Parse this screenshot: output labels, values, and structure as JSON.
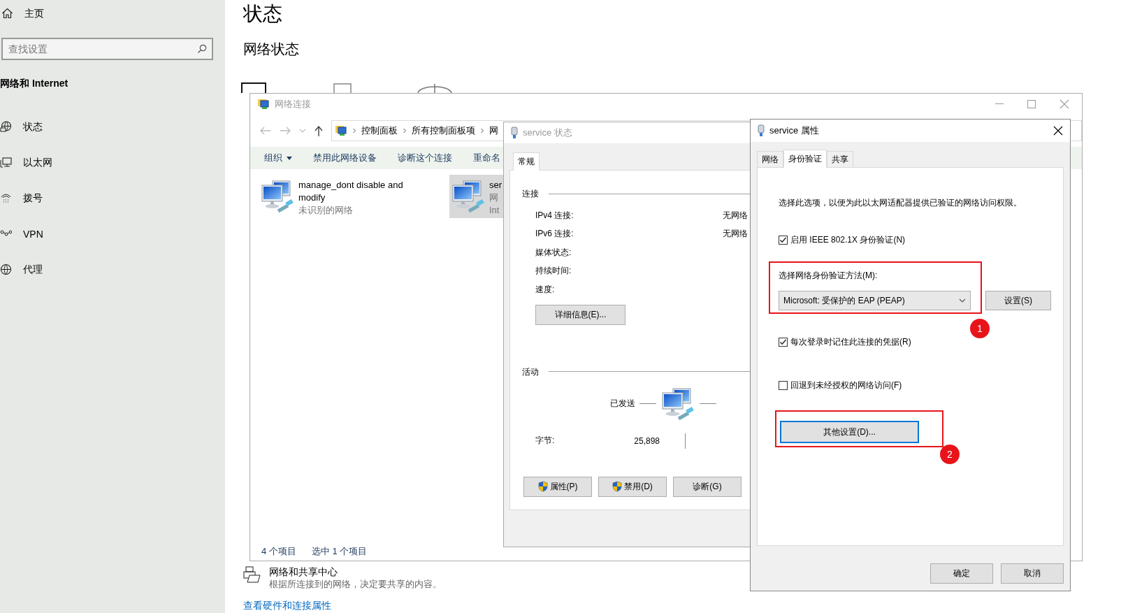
{
  "settings_sidebar": {
    "home": "主页",
    "search": {
      "placeholder": "查找设置"
    },
    "section_title": "网络和 Internet",
    "items": [
      {
        "label": "状态"
      },
      {
        "label": "以太网"
      },
      {
        "label": "拨号"
      },
      {
        "label": "VPN"
      },
      {
        "label": "代理"
      }
    ]
  },
  "page": {
    "title": "状态",
    "subtitle": "网络状态",
    "sharing_center": {
      "title": "网络和共享中心",
      "description": "根据所连接到的网络，决定要共享的内容。"
    },
    "link": "查看硬件和连接属性"
  },
  "connections_window": {
    "title": "网络连接",
    "active": false,
    "breadcrumb": [
      "控制面板",
      "所有控制面板项",
      "网"
    ],
    "toolbar": [
      {
        "label": "组织",
        "kind": "menu"
      },
      {
        "label": "禁用此网络设备",
        "kind": "action"
      },
      {
        "label": "诊断这个连接",
        "kind": "action"
      },
      {
        "label": "重命名",
        "kind": "action"
      }
    ],
    "items": [
      {
        "name": "manage_dont disable and modify",
        "status": "未识别的网络",
        "selected": false
      },
      {
        "name": "ser",
        "status": "网",
        "device": "Int",
        "selected": true
      }
    ],
    "status_bar": [
      "4 个项目",
      "选中 1 个项目"
    ]
  },
  "status_dialog": {
    "title": "service 状态",
    "active": false,
    "tabs": [
      {
        "label": "常规",
        "selected": true
      }
    ],
    "connection": {
      "heading": "连接",
      "rows": [
        {
          "label": "IPv4 连接:",
          "value": "无网络"
        },
        {
          "label": "IPv6 连接:",
          "value": "无网络"
        },
        {
          "label": "媒体状态:"
        },
        {
          "label": "持续时间:"
        },
        {
          "label": "速度:"
        }
      ],
      "details_button": "详细信息(E)..."
    },
    "activity": {
      "heading": "活动",
      "sent_label": "已发送",
      "bytes_label": "字节:",
      "bytes_sent": "25,898"
    },
    "buttons": [
      {
        "label": "属性(P)",
        "shield": true
      },
      {
        "label": "禁用(D)",
        "shield": true
      },
      {
        "label": "诊断(G)",
        "shield": false
      }
    ]
  },
  "props_dialog": {
    "title": "service 属性",
    "active": true,
    "tabs": [
      {
        "label": "网络",
        "selected": false
      },
      {
        "label": "身份验证",
        "selected": true
      },
      {
        "label": "共享",
        "selected": false
      }
    ],
    "description": "选择此选项，以便为此以太网适配器提供已验证的网络访问权限。",
    "enable_8021x": {
      "label": "启用 IEEE 802.1X 身份验证(N)",
      "checked": true
    },
    "method": {
      "label": "选择网络身份验证方法(M):",
      "value": "Microsoft: 受保护的 EAP (PEAP)",
      "settings_button": {
        "label": "设置(S)",
        "focused": false
      }
    },
    "remember": {
      "label": "每次登录时记住此连接的凭据(R)",
      "checked": true
    },
    "fallback": {
      "label": "回退到未经授权的网络访问(F)",
      "checked": false
    },
    "additional_settings": {
      "label": "其他设置(D)...",
      "focused": true
    },
    "annotations": [
      {
        "label": "1"
      },
      {
        "label": "2"
      }
    ],
    "buttons": [
      "确定",
      "取消"
    ]
  }
}
